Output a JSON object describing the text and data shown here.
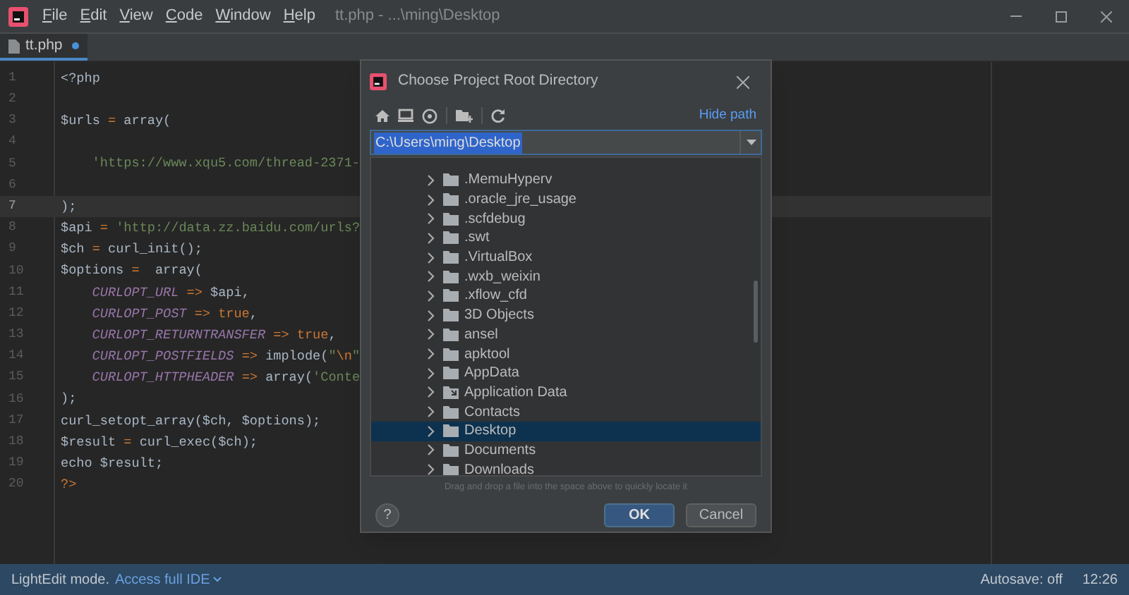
{
  "window": {
    "title": "tt.php - ...\\ming\\Desktop"
  },
  "menu": [
    {
      "mnemonic": "F",
      "rest": "ile"
    },
    {
      "mnemonic": "E",
      "rest": "dit"
    },
    {
      "mnemonic": "V",
      "rest": "iew"
    },
    {
      "mnemonic": "C",
      "rest": "ode"
    },
    {
      "mnemonic": "W",
      "rest": "indow"
    },
    {
      "mnemonic": "H",
      "rest": "elp"
    }
  ],
  "tabs": [
    {
      "label": "tt.php",
      "selected": true,
      "modified": true
    }
  ],
  "editor": {
    "lines": [
      {
        "number": "1",
        "current": false,
        "indented": false,
        "tokens": [
          {
            "kind": "plain",
            "text": "<?php"
          }
        ]
      },
      {
        "number": "2",
        "current": false
      },
      {
        "number": "3",
        "current": false,
        "indented": false,
        "tokens": [
          {
            "kind": "plain",
            "text": "$urls"
          },
          {
            "kind": "operator",
            "text": " = "
          },
          {
            "kind": "plain",
            "text": "array("
          }
        ]
      },
      {
        "number": "4",
        "current": false
      },
      {
        "number": "5",
        "current": false,
        "indented": true,
        "tokens": [
          {
            "kind": "string",
            "text": "'https://www.xqu5.com/thread-2371-"
          }
        ]
      },
      {
        "number": "6",
        "current": false
      },
      {
        "number": "7",
        "current": true,
        "indented": false,
        "tokens": [
          {
            "kind": "plain",
            "text": ");"
          }
        ]
      },
      {
        "number": "8",
        "current": false,
        "indented": false,
        "tokens": [
          {
            "kind": "plain",
            "text": "$api"
          },
          {
            "kind": "operator",
            "text": " = "
          },
          {
            "kind": "string",
            "text": "'http://data.zz.baidu.com/urls?"
          }
        ]
      },
      {
        "number": "9",
        "current": false,
        "indented": false,
        "tokens": [
          {
            "kind": "plain",
            "text": "$ch"
          },
          {
            "kind": "operator",
            "text": " = "
          },
          {
            "kind": "plain",
            "text": "curl_init();"
          }
        ]
      },
      {
        "number": "10",
        "current": false,
        "indented": false,
        "tokens": [
          {
            "kind": "plain",
            "text": "$options"
          },
          {
            "kind": "operator",
            "text": " =  "
          },
          {
            "kind": "plain",
            "text": "array("
          }
        ]
      },
      {
        "number": "11",
        "current": false,
        "indented": true,
        "tokens": [
          {
            "kind": "constant",
            "text": "CURLOPT_URL"
          },
          {
            "kind": "operator",
            "text": " => "
          },
          {
            "kind": "plain",
            "text": "$api,"
          }
        ]
      },
      {
        "number": "12",
        "current": false,
        "indented": true,
        "tokens": [
          {
            "kind": "constant",
            "text": "CURLOPT_POST"
          },
          {
            "kind": "operator",
            "text": " => true"
          },
          {
            "kind": "plain",
            "text": ","
          }
        ]
      },
      {
        "number": "13",
        "current": false,
        "indented": true,
        "tokens": [
          {
            "kind": "constant",
            "text": "CURLOPT_RETURNTRANSFER"
          },
          {
            "kind": "operator",
            "text": " => true"
          },
          {
            "kind": "plain",
            "text": ","
          }
        ]
      },
      {
        "number": "14",
        "current": false,
        "indented": true,
        "tokens": [
          {
            "kind": "constant",
            "text": "CURLOPT_POSTFIELDS"
          },
          {
            "kind": "operator",
            "text": " => "
          },
          {
            "kind": "plain",
            "text": "implode("
          },
          {
            "kind": "string",
            "text": "\""
          },
          {
            "kind": "operator",
            "text": "\\n"
          },
          {
            "kind": "string",
            "text": "\""
          }
        ]
      },
      {
        "number": "15",
        "current": false,
        "indented": true,
        "tokens": [
          {
            "kind": "constant",
            "text": "CURLOPT_HTTPHEADER"
          },
          {
            "kind": "operator",
            "text": " => "
          },
          {
            "kind": "plain",
            "text": "array("
          },
          {
            "kind": "string",
            "text": "'Conte"
          }
        ]
      },
      {
        "number": "16",
        "current": false,
        "indented": false,
        "tokens": [
          {
            "kind": "plain",
            "text": ");"
          }
        ]
      },
      {
        "number": "17",
        "current": false,
        "indented": false,
        "tokens": [
          {
            "kind": "plain",
            "text": "curl_setopt_array($ch, $options);"
          }
        ]
      },
      {
        "number": "18",
        "current": false,
        "indented": false,
        "tokens": [
          {
            "kind": "plain",
            "text": "$result"
          },
          {
            "kind": "operator",
            "text": " = "
          },
          {
            "kind": "plain",
            "text": "curl_exec($ch);"
          }
        ]
      },
      {
        "number": "19",
        "current": false,
        "indented": false,
        "tokens": [
          {
            "kind": "plain",
            "text": "echo $result;"
          }
        ]
      },
      {
        "number": "20",
        "current": false,
        "indented": false,
        "tokens": [
          {
            "kind": "operator",
            "text": "?>"
          }
        ]
      }
    ]
  },
  "dialog": {
    "title": "Choose Project Root Directory",
    "hide_path": "Hide path",
    "path": "C:\\Users\\ming\\Desktop",
    "tree": [
      {
        "kind": "folder",
        "label": ".MemuHyperv",
        "selected": false
      },
      {
        "kind": "folder",
        "label": ".oracle_jre_usage",
        "selected": false
      },
      {
        "kind": "folder",
        "label": ".scfdebug",
        "selected": false
      },
      {
        "kind": "folder",
        "label": ".swt",
        "selected": false
      },
      {
        "kind": "folder",
        "label": ".VirtualBox",
        "selected": false
      },
      {
        "kind": "folder",
        "label": ".wxb_weixin",
        "selected": false
      },
      {
        "kind": "folder",
        "label": ".xflow_cfd",
        "selected": false
      },
      {
        "kind": "folder",
        "label": "3D Objects",
        "selected": false
      },
      {
        "kind": "folder",
        "label": "ansel",
        "selected": false
      },
      {
        "kind": "folder",
        "label": "apktool",
        "selected": false
      },
      {
        "kind": "folder",
        "label": "AppData",
        "selected": false
      },
      {
        "kind": "link",
        "label": "Application Data",
        "selected": false
      },
      {
        "kind": "folder",
        "label": "Contacts",
        "selected": false
      },
      {
        "kind": "folder",
        "label": "Desktop",
        "selected": true
      },
      {
        "kind": "folder",
        "label": "Documents",
        "selected": false
      },
      {
        "kind": "folder",
        "label": "Downloads",
        "selected": false
      }
    ],
    "hint": "Drag and drop a file into the space above to quickly locate it",
    "help": "?",
    "buttons": [
      {
        "label": "OK",
        "kind": "primary"
      },
      {
        "label": "Cancel",
        "kind": "secondary"
      }
    ]
  },
  "status_bar": {
    "mode": "LightEdit mode.",
    "link": "Access full IDE",
    "autosave": "Autosave: off",
    "time": "12:26"
  }
}
